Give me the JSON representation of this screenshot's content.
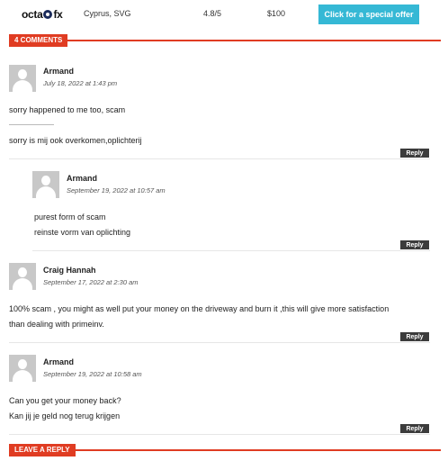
{
  "broker": {
    "logo_left": "octa",
    "logo_right": "fx",
    "regulation": "Cyprus, SVG",
    "rating": "4.8/5",
    "min_deposit": "$100",
    "cta": "Click for a special offer"
  },
  "comments_section": {
    "title": "4 COMMENTS"
  },
  "comments": [
    {
      "author": "Armand",
      "date": "July 18, 2022 at 1:43 pm",
      "lines": [
        "sorry happened to me too, scam",
        "sorry is mij ook overkomen,oplichterij"
      ],
      "reply": "Reply"
    },
    {
      "author": "Armand",
      "date": "September 19, 2022 at 10:57 am",
      "lines": [
        "purest form of scam",
        "reinste vorm van oplichting"
      ],
      "reply": "Reply"
    },
    {
      "author": "Craig Hannah",
      "date": "September 17, 2022 at 2:30 am",
      "lines": [
        "100% scam , you might as well put your money on the driveway and burn it ,this will give more satisfaction",
        "than dealing with primeinv."
      ],
      "reply": "Reply"
    },
    {
      "author": "Armand",
      "date": "September 19, 2022 at 10:58 am",
      "lines": [
        "Can you get your money back?",
        "Kan jij je geld nog terug krijgen"
      ],
      "reply": "Reply"
    }
  ],
  "leave_reply": {
    "title": "LEAVE A REPLY"
  }
}
